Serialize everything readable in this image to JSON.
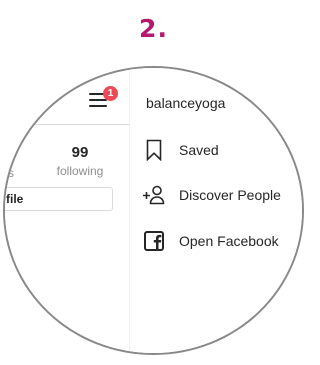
{
  "step": {
    "number": "2.",
    "color": "#b5196e"
  },
  "profile": {
    "partial_stat_label": "s",
    "following_count": "99",
    "following_label": "following",
    "edit_button_label": "file"
  },
  "header": {
    "menu_icon": "hamburger-icon",
    "notification_badge": "1",
    "badge_color": "#ed4956"
  },
  "menu": {
    "username": "balanceyoga",
    "items": [
      {
        "label": "Saved",
        "icon": "bookmark-icon"
      },
      {
        "label": "Discover People",
        "icon": "add-person-icon"
      },
      {
        "label": "Open Facebook",
        "icon": "facebook-icon"
      }
    ]
  }
}
